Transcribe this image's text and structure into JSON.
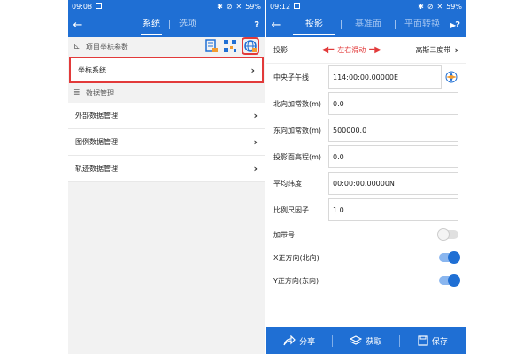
{
  "left": {
    "status": {
      "time": "09:08",
      "battery": "59%"
    },
    "tabs": [
      {
        "label": "系统"
      },
      {
        "label": "选项"
      }
    ],
    "help": "?",
    "project_group": "项目坐标参数",
    "coord_system": "坐标系统",
    "data_group": "数据管理",
    "items": [
      "外部数据管理",
      "图例数据管理",
      "轨迹数据管理"
    ]
  },
  "right": {
    "status": {
      "time": "09:12",
      "battery": "59%"
    },
    "tabs": [
      {
        "label": "投影"
      },
      {
        "label": "基准面"
      },
      {
        "label": "平面转换"
      }
    ],
    "help": "?",
    "projection": {
      "label": "投影",
      "hint": "左右滑动",
      "value": "高斯三度带"
    },
    "fields": [
      {
        "label": "中央子午线",
        "value": "114:00:00.00000E"
      },
      {
        "label": "北向加常数(m)",
        "value": "0.0"
      },
      {
        "label": "东向加常数(m)",
        "value": "500000.0"
      },
      {
        "label": "投影面高程(m)",
        "value": "0.0"
      },
      {
        "label": "平均纬度",
        "value": "00:00:00.00000N"
      },
      {
        "label": "比例尺因子",
        "value": "1.0"
      }
    ],
    "toggles": [
      {
        "label": "加带号",
        "state": "off"
      },
      {
        "label": "X正方向(北向)",
        "state": "on"
      },
      {
        "label": "Y正方向(东向)",
        "state": "on"
      }
    ],
    "buttons": {
      "share": "分享",
      "get": "获取",
      "save": "保存"
    }
  },
  "colors": {
    "primary": "#1f6fd4",
    "highlight": "#e23a3a"
  }
}
